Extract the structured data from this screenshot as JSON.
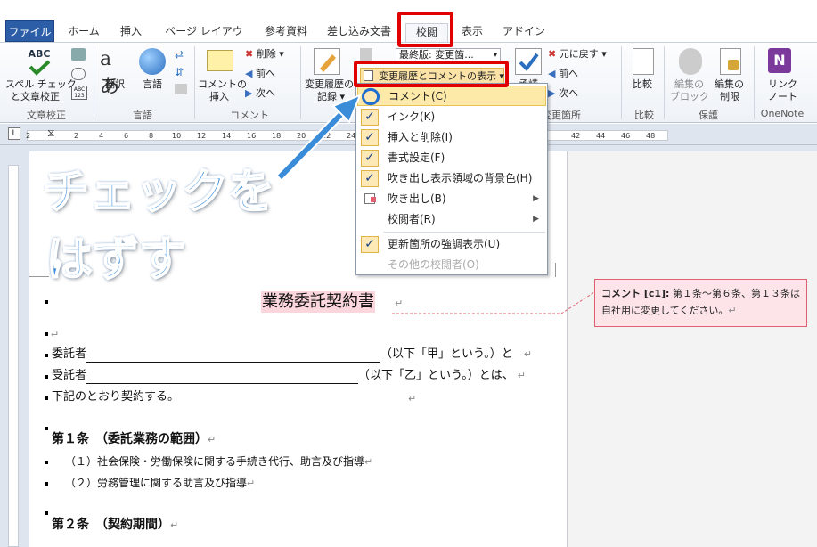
{
  "tabs": [
    "ファイル",
    "ホーム",
    "挿入",
    "ページ レイアウト",
    "参考資料",
    "差し込み文書",
    "校閲",
    "表示",
    "アドイン"
  ],
  "ribbon": {
    "proofing": {
      "spell": "スペル チェック",
      "spell2": "と文章校正",
      "abc": "ABC",
      "group": "文章校正"
    },
    "language": {
      "translate": "翻訳",
      "lang": "言語",
      "group": "言語"
    },
    "comments": {
      "new": "コメントの",
      "new2": "挿入",
      "delete": "削除",
      "prev": "前へ",
      "next": "次へ",
      "group": "コメント"
    },
    "tracking": {
      "track": "変更履歴の",
      "track2": "記録",
      "display_value": "最終版: 変更箇...",
      "show_markup": "変更履歴とコメントの表示",
      "group": "変更箇所"
    },
    "changes": {
      "accept": "承諾",
      "reject": "元に戻す",
      "prev": "前へ",
      "next": "次へ",
      "group": "変更箇所"
    },
    "compare": {
      "label": "比較",
      "group": "比較"
    },
    "protect": {
      "block": "編集の",
      "block2": "ブロック",
      "restrict": "編集の",
      "restrict2": "制限",
      "group": "保護"
    },
    "onenote": {
      "link": "リンク",
      "link2": "ノート",
      "group": "OneNote"
    }
  },
  "ruler": {
    "corner": "L",
    "marks": [
      "2",
      "2",
      "4",
      "6",
      "8",
      "10",
      "12",
      "14",
      "16",
      "18",
      "20",
      "22",
      "24",
      "42",
      "44",
      "46",
      "48"
    ]
  },
  "menu": {
    "items": [
      {
        "label": "コメント(C)",
        "checked": true
      },
      {
        "label": "インク(K)",
        "checked": true
      },
      {
        "label": "挿入と削除(I)",
        "checked": true
      },
      {
        "label": "書式設定(F)",
        "checked": true
      },
      {
        "label": "吹き出し表示領域の背景色(H)",
        "checked": true
      },
      {
        "label": "吹き出し(B)",
        "submenu": true
      },
      {
        "label": "校閲者(R)",
        "submenu": true
      },
      {
        "label": "更新箇所の強調表示(U)",
        "checked": true
      },
      {
        "label": "その他の校閲者(O)",
        "disabled": true
      }
    ]
  },
  "annotation": {
    "line1": "チェックを",
    "line2": "はずす"
  },
  "document": {
    "title": "業務委託契約書",
    "lines": [
      "委託者",
      "（以下「甲」という。）と",
      "受託者",
      "（以下「乙」という。）とは、",
      "下記のとおり契約する。",
      "第１条　（委託業務の範囲）",
      "（１）社会保険・労働保険に関する手続き代行、助言及び指導",
      "（２）労務管理に関する助言及び指導",
      "第２条　（契約期間）"
    ],
    "para_mark": "↵"
  },
  "comment": {
    "head": "コメント [c1]:",
    "body1": " 第１条～第６条、第１３条は",
    "body2": "自社用に変更してください。"
  },
  "colors": {
    "file_tab": "#2c5ea8",
    "highlight": "#e00000",
    "comment_bg": "#fde4e8",
    "annotation": "#3a8cd8"
  }
}
